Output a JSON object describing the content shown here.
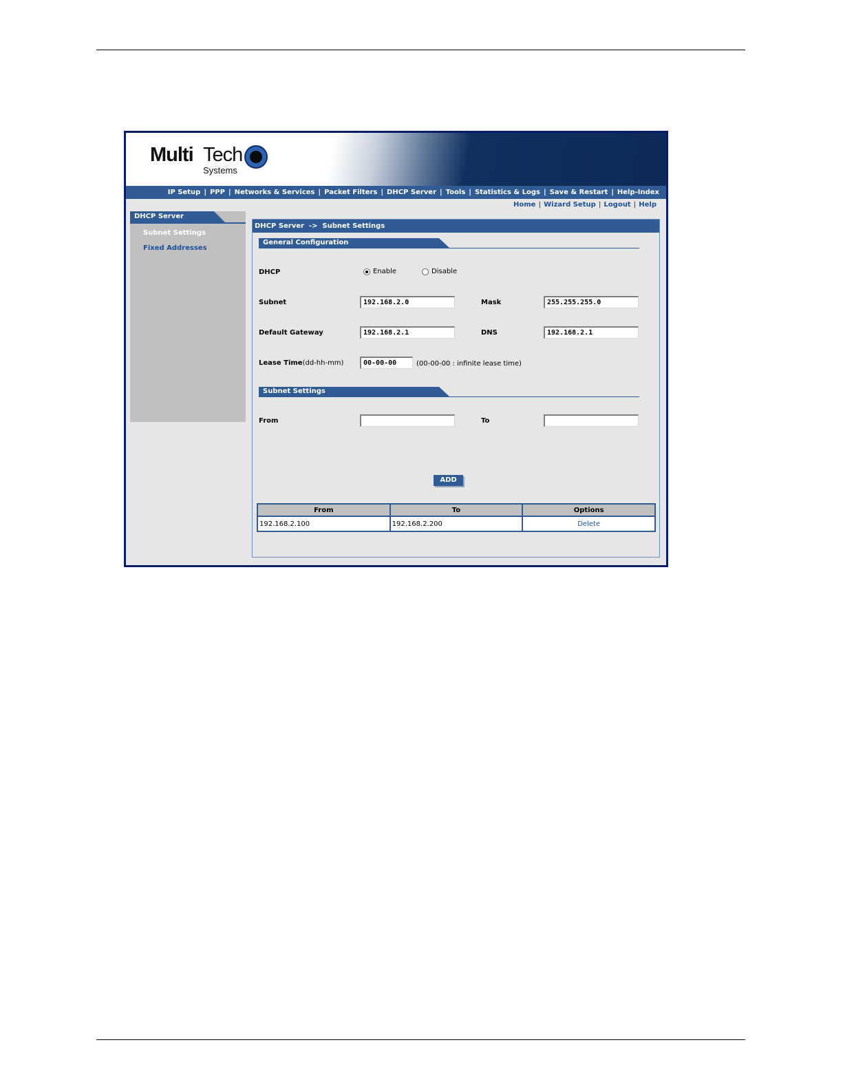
{
  "logo": {
    "brand_bold": "Multi",
    "brand_light": "Tech",
    "sub": "Systems"
  },
  "topnav": [
    "IP Setup",
    "PPP",
    "Networks & Services",
    "Packet Filters",
    "DHCP Server",
    "Tools",
    "Statistics & Logs",
    "Save & Restart",
    "Help-Index"
  ],
  "utilnav": [
    "Home",
    "Wizard Setup",
    "Logout",
    "Help"
  ],
  "sidebar": {
    "title": "DHCP Server",
    "items": [
      {
        "label": "Subnet Settings",
        "active": true
      },
      {
        "label": "Fixed Addresses",
        "active": false
      }
    ]
  },
  "main": {
    "breadcrumb": "DHCP Server  ->  Subnet Settings",
    "general": {
      "title": "General Configuration",
      "dhcp_label": "DHCP",
      "enable_label": "Enable",
      "disable_label": "Disable",
      "dhcp_selected": "Enable",
      "subnet_label": "Subnet",
      "subnet_value": "192.168.2.0",
      "mask_label": "Mask",
      "mask_value": "255.255.255.0",
      "gateway_label": "Default Gateway",
      "gateway_value": "192.168.2.1",
      "dns_label": "DNS",
      "dns_value": "192.168.2.1",
      "lease_label": "Lease Time",
      "lease_format": "(dd-hh-mm)",
      "lease_value": "00-00-00",
      "lease_note": "(00-00-00 : infinite lease time)"
    },
    "subnet": {
      "title": "Subnet Settings",
      "from_label": "From",
      "from_value": "",
      "to_label": "To",
      "to_value": "",
      "add_label": "ADD"
    },
    "table": {
      "headers": [
        "From",
        "To",
        "Options"
      ],
      "rows": [
        {
          "from": "192.168.2.100",
          "to": "192.168.2.200",
          "option": "Delete"
        }
      ]
    }
  }
}
